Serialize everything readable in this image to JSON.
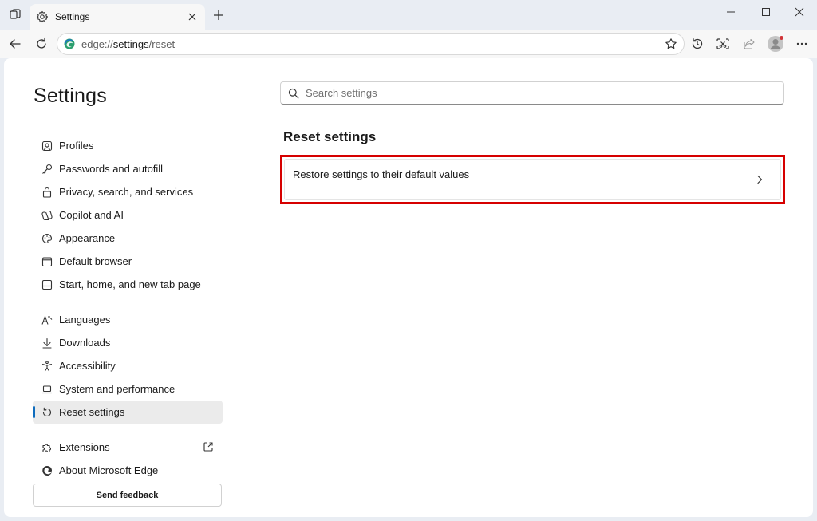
{
  "tab": {
    "title": "Settings"
  },
  "address": {
    "scheme": "edge://",
    "host": "settings",
    "path": "/reset"
  },
  "page": {
    "title": "Settings"
  },
  "sidebar": {
    "group1": [
      {
        "label": "Profiles",
        "icon": "profile-icon"
      },
      {
        "label": "Passwords and autofill",
        "icon": "key-icon"
      },
      {
        "label": "Privacy, search, and services",
        "icon": "lock-icon"
      },
      {
        "label": "Copilot and AI",
        "icon": "copilot-icon"
      },
      {
        "label": "Appearance",
        "icon": "palette-icon"
      },
      {
        "label": "Default browser",
        "icon": "browser-icon"
      },
      {
        "label": "Start, home, and new tab page",
        "icon": "home-tab-icon"
      }
    ],
    "group2": [
      {
        "label": "Languages",
        "icon": "language-icon"
      },
      {
        "label": "Downloads",
        "icon": "download-icon"
      },
      {
        "label": "Accessibility",
        "icon": "accessibility-icon"
      },
      {
        "label": "System and performance",
        "icon": "laptop-icon"
      },
      {
        "label": "Reset settings",
        "icon": "reset-icon",
        "active": true
      }
    ],
    "group3": [
      {
        "label": "Extensions",
        "icon": "puzzle-icon"
      },
      {
        "label": "About Microsoft Edge",
        "icon": "edge-icon"
      }
    ]
  },
  "feedback": {
    "label": "Send feedback"
  },
  "search": {
    "placeholder": "Search settings"
  },
  "main": {
    "section_title": "Reset settings",
    "restore_label": "Restore settings to their default values"
  },
  "colors": {
    "accent": "#0f6cbd",
    "highlight_border": "#d60000",
    "active_bg": "#ebebeb",
    "chrome_bg": "#e9edf3"
  }
}
